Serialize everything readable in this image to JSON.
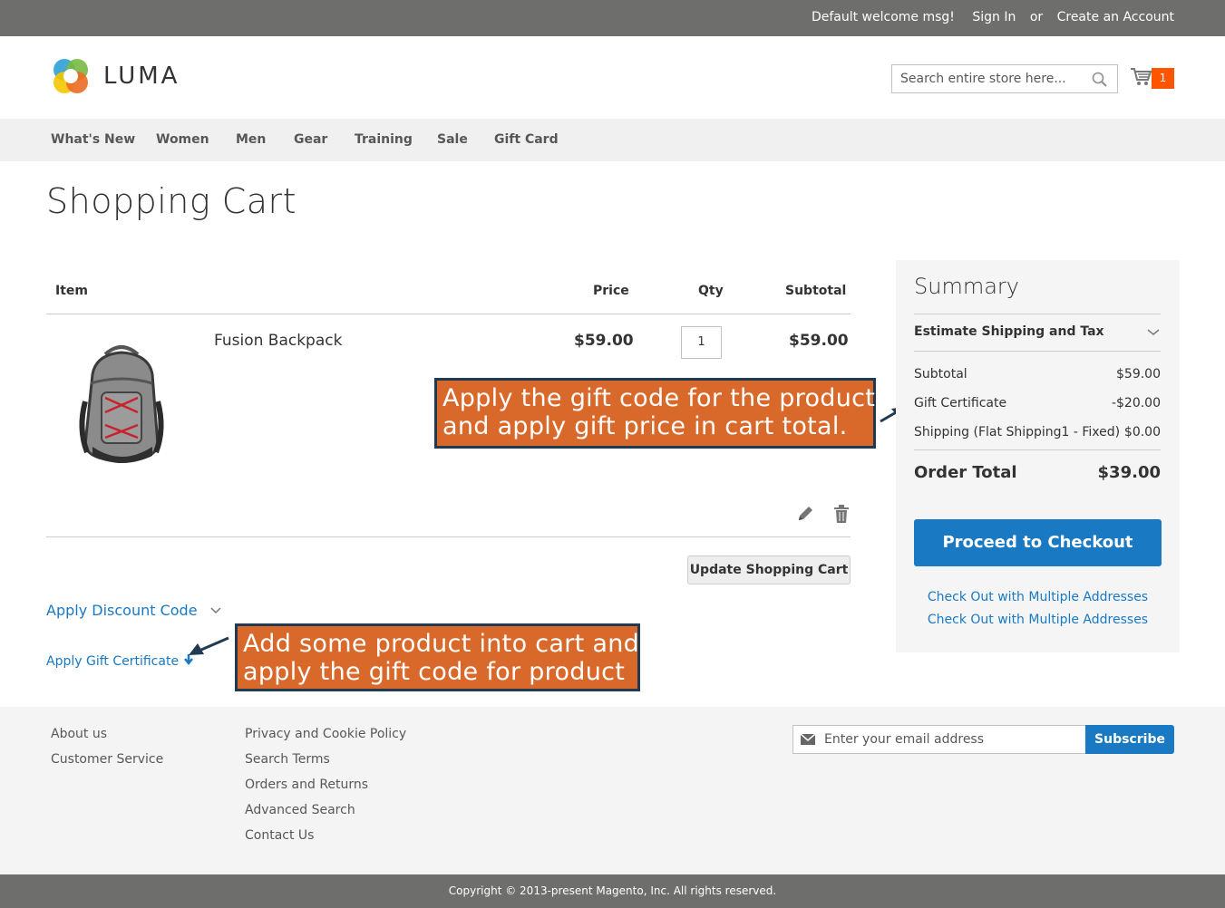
{
  "topbar": {
    "welcome": "Default welcome msg!",
    "sign_in": "Sign In",
    "or": "or",
    "create_account": "Create an Account"
  },
  "header": {
    "logo_text": "LUMA",
    "search_placeholder": "Search entire store here...",
    "cart_count": "1"
  },
  "nav": {
    "items": [
      "What's New",
      "Women",
      "Men",
      "Gear",
      "Training",
      "Sale",
      "Gift Card"
    ]
  },
  "page_title": "Shopping Cart",
  "cart": {
    "columns": {
      "item": "Item",
      "price": "Price",
      "qty": "Qty",
      "subtotal": "Subtotal"
    },
    "items": [
      {
        "name": "Fusion Backpack",
        "price": "$59.00",
        "qty": "1",
        "subtotal": "$59.00"
      }
    ],
    "update_button": "Update Shopping Cart",
    "apply_discount": "Apply Discount Code",
    "apply_gift": "Apply Gift Certificate"
  },
  "callouts": {
    "summary_line1": "Apply the gift code for the product",
    "summary_line2": "and apply gift price in cart total.",
    "gift_line1": "Add some product into cart and",
    "gift_line2": "apply the gift code for product"
  },
  "summary": {
    "title": "Summary",
    "estimate": "Estimate Shipping and Tax",
    "rows": [
      {
        "label": "Subtotal",
        "value": "$59.00"
      },
      {
        "label": "Gift Certificate",
        "value": "-$20.00"
      },
      {
        "label": "Shipping (Flat Shipping1 - Fixed)",
        "value": "$0.00"
      }
    ],
    "order_total_label": "Order Total",
    "order_total_value": "$39.00",
    "checkout_button": "Proceed to Checkout",
    "multi_address_1": "Check Out with Multiple Addresses",
    "multi_address_2": "Check Out with Multiple Addresses"
  },
  "footer": {
    "col1": [
      "About us",
      "Customer Service"
    ],
    "col2": [
      "Privacy and Cookie Policy",
      "Search Terms",
      "Orders and Returns",
      "Advanced Search",
      "Contact Us"
    ],
    "email_placeholder": "Enter your email address",
    "subscribe": "Subscribe",
    "copyright": "Copyright © 2013-present Magento, Inc. All rights reserved."
  },
  "colors": {
    "topbar": "#6e6e6c",
    "link_blue": "#1979c3",
    "cart_badge": "#ff5501",
    "callout_bg": "#d9692b",
    "callout_border": "#1f3a52"
  }
}
